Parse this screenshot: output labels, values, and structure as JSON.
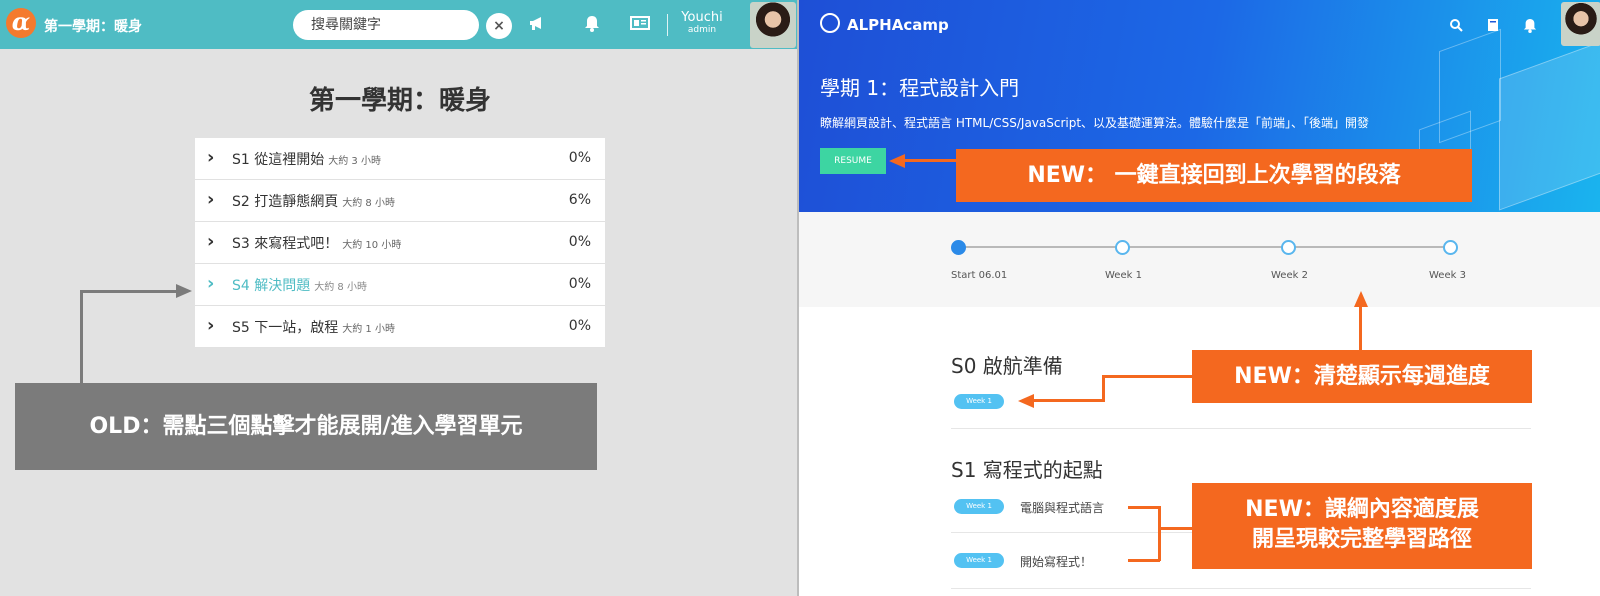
{
  "old": {
    "topbar": {
      "title": "第一學期：暖身",
      "search_placeholder": "搜尋關鍵字",
      "clear_label": "×",
      "username": "Youchi",
      "role": "admin"
    },
    "heading": "第一學期：暖身",
    "sections": [
      {
        "name": "S1 從這裡開始",
        "duration": "大約 3 小時",
        "progress": "0%"
      },
      {
        "name": "S2 打造靜態網頁",
        "duration": "大約 8 小時",
        "progress": "6%"
      },
      {
        "name": "S3 來寫程式吧！",
        "duration": "大約 10 小時",
        "progress": "0%"
      },
      {
        "name": "S4 解決問題",
        "duration": "大約 8 小時",
        "progress": "0%"
      },
      {
        "name": "S5 下一站，啟程",
        "duration": "大約 1 小時",
        "progress": "0%"
      }
    ],
    "callout": "OLD：需點三個點擊才能展開/進入學習單元"
  },
  "new": {
    "brand": "ALPHAcamp",
    "hero": {
      "title": "學期 1：程式設計入門",
      "description": "瞭解網頁設計、程式語言 HTML/CSS/JavaScript、以及基礎運算法。體驗什麼是「前端」、「後端」開發",
      "resume_label": "RESUME"
    },
    "timeline": [
      "Start 06.01",
      "Week 1",
      "Week 2",
      "Week 3"
    ],
    "sections": [
      {
        "title": "S0 啟航準備",
        "badge": "Week 1"
      },
      {
        "title": "S1 寫程式的起點",
        "lessons": [
          {
            "badge": "Week 1",
            "label": "電腦與程式語言"
          },
          {
            "badge": "Week 1",
            "label": "開始寫程式！"
          }
        ]
      }
    ],
    "callouts": {
      "resume": "NEW： 一鍵直接回到上次學習的段落",
      "progress": "NEW：清楚顯示每週進度",
      "outline_line1": "NEW：課綱內容適度展",
      "outline_line2": "開呈現較完整學習路徑"
    }
  },
  "colors": {
    "old_topbar": "#4fbcc4",
    "accent_orange": "#f4681f",
    "old_callout_gray": "#7b7b7b",
    "resume_green": "#3dd5a2",
    "badge_blue": "#53c2f2"
  },
  "icons": [
    "alpha-logo-icon",
    "clear-icon",
    "megaphone-icon",
    "bell-icon",
    "news-icon",
    "search-icon",
    "bookmark-icon"
  ]
}
